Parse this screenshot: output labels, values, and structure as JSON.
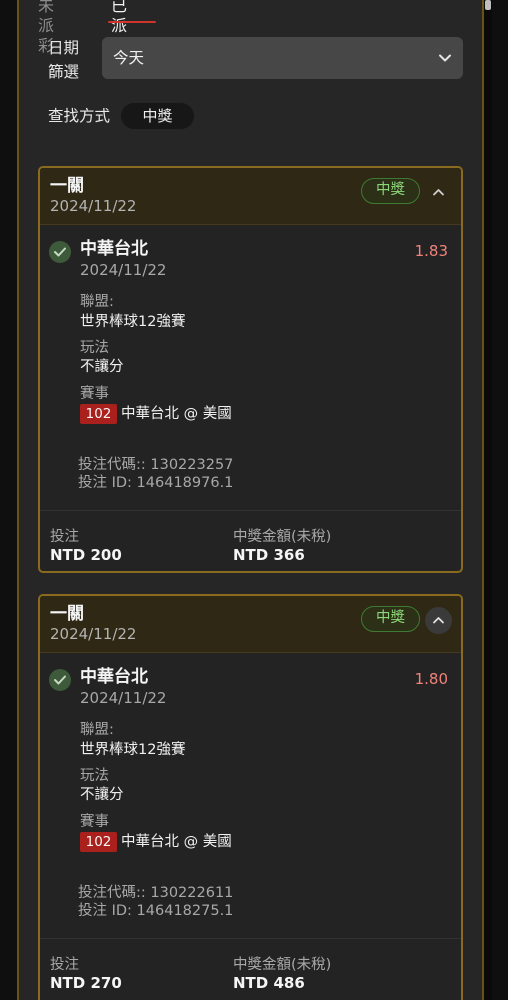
{
  "tabs": [
    {
      "label": "未派彩",
      "active": false
    },
    {
      "label": "已派彩",
      "active": true
    }
  ],
  "filter": {
    "date_label": "日期篩選",
    "date_value": "今天",
    "search_label": "查找方式",
    "search_value": "中獎"
  },
  "colors": {
    "accent_gold": "#8a6a1e",
    "active_tab_underline": "#d0342b",
    "win_green": "#8cd67a",
    "odds_red": "#f0837a",
    "event_badge_red": "#a9201c"
  },
  "cards": [
    {
      "title": "一關",
      "date": "2024/11/22",
      "status": "中獎",
      "collapse_icon": "chevron-up-icon",
      "bet": {
        "team": "中華台北",
        "date": "2024/11/22",
        "odds": "1.83",
        "league_label": "聯盟:",
        "league": "世界棒球12強賽",
        "play_label": "玩法",
        "play": "不讓分",
        "event_label": "賽事",
        "event_code": "102",
        "event_name": "中華台北 @ 美國"
      },
      "code_line": "投注代碼:: 130223257",
      "id_line": "投注 ID: 146418976.1",
      "stake_label": "投注",
      "stake": "NTD 200",
      "payout_label": "中獎金額(未稅)",
      "payout": "NTD 366"
    },
    {
      "title": "一關",
      "date": "2024/11/22",
      "status": "中獎",
      "collapse_icon": "chevron-up-icon",
      "bet": {
        "team": "中華台北",
        "date": "2024/11/22",
        "odds": "1.80",
        "league_label": "聯盟:",
        "league": "世界棒球12強賽",
        "play_label": "玩法",
        "play": "不讓分",
        "event_label": "賽事",
        "event_code": "102",
        "event_name": "中華台北 @ 美國"
      },
      "code_line": "投注代碼:: 130222611",
      "id_line": "投注 ID: 146418275.1",
      "stake_label": "投注",
      "stake": "NTD 270",
      "payout_label": "中獎金額(未稅)",
      "payout": "NTD 486"
    }
  ]
}
